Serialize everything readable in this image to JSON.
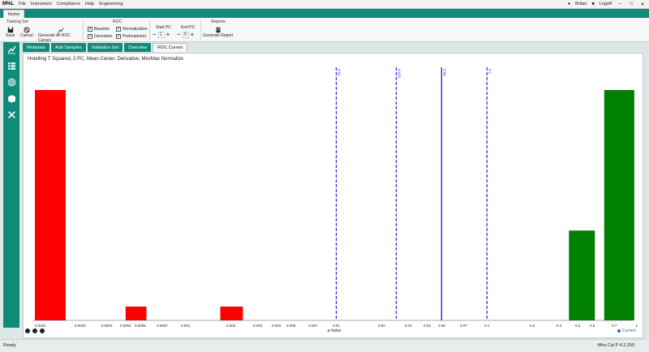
{
  "app": {
    "logo": "M%L",
    "menu": [
      "File",
      "Instrument",
      "Compliance",
      "Help",
      "Engineering"
    ],
    "user": "Britan",
    "logoff": "Logoff"
  },
  "home_tab": "Home",
  "ribbon": {
    "training_set": {
      "title": "Training Set",
      "save": "Save",
      "cancel": "Cancel",
      "generate": "Generate All ROC Curves"
    },
    "roc": {
      "title": "ROC",
      "baseline": "Baseline",
      "derivative": "Derivative",
      "normalization": "Normalization",
      "pretreatment": "Pretreatment"
    },
    "start_pc": {
      "label": "Start PC",
      "value": "1"
    },
    "end_pc": {
      "label": "End PC",
      "value": "5"
    },
    "reports": {
      "title": "Reports",
      "generate": "Generate Report"
    }
  },
  "tabs": [
    "Metadata",
    "Add Samples",
    "Validation Set",
    "Overview",
    "ROC Curves"
  ],
  "active_tab": "ROC Curves",
  "chart_data": {
    "type": "bar",
    "title": "Hotelling T Squared, 2 PC, Mean Center, Derivative, Min/Max Normalize",
    "xlabel": "p-Value",
    "xscale": "log",
    "xlim": [
      0.0001,
      1
    ],
    "ticks": [
      "0.0001",
      "0.0002",
      "0.0003",
      "0.0004",
      "0.0005",
      "0.0007",
      "0.001",
      "0.002",
      "0.003",
      "0.004",
      "0.005",
      "0.007",
      "0.01",
      "0.02",
      "0.03",
      "0.04",
      "0.05",
      "0.07",
      "0.1",
      "0.2",
      "0.3",
      "0.4",
      "0.5",
      "0.7",
      "1"
    ],
    "series": [
      {
        "color": "#ff0000",
        "bars": [
          {
            "x0": 0.0001,
            "x1": 0.00016,
            "value": 1.0
          },
          {
            "x0": 0.0004,
            "x1": 0.00055,
            "value": 0.06
          },
          {
            "x0": 0.0017,
            "x1": 0.0024,
            "value": 0.06
          }
        ]
      },
      {
        "color": "#008000",
        "bars": [
          {
            "x0": 0.35,
            "x1": 0.52,
            "value": 0.39
          },
          {
            "x0": 0.6,
            "x1": 0.95,
            "value": 1.0
          }
        ]
      }
    ],
    "thresholds": [
      {
        "x": 0.01,
        "label": "0.01",
        "style": "dashed"
      },
      {
        "x": 0.025,
        "label": "0.025",
        "style": "dashed"
      },
      {
        "x": 0.05,
        "label": "0.05",
        "style": "solid"
      },
      {
        "x": 0.1,
        "label": "0.1",
        "style": "dashed"
      }
    ],
    "legend": "Current",
    "grid": false
  },
  "status": {
    "left": "Ready",
    "version": "Mira Cal P 4.2.200"
  }
}
